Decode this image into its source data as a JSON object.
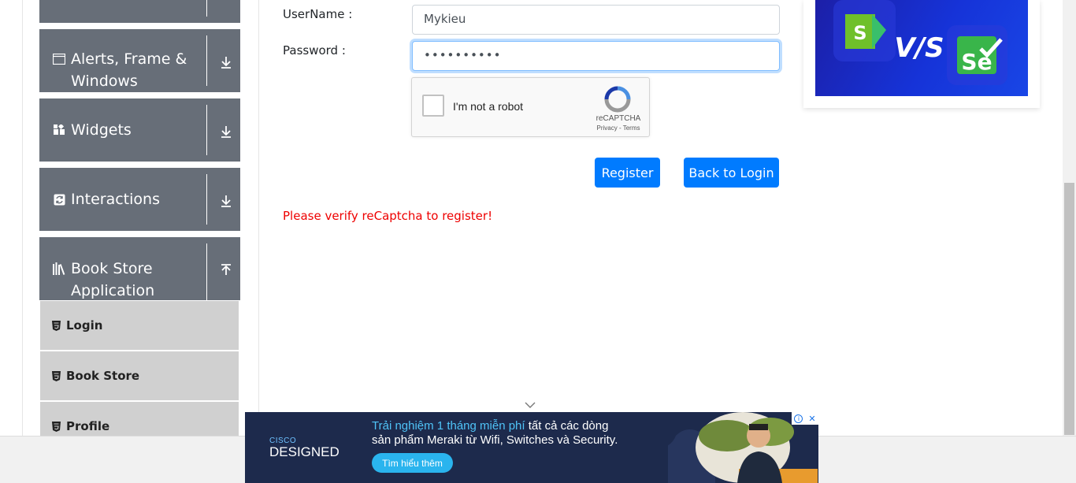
{
  "sidebar": {
    "groups": [
      {
        "label": "Alerts, Frame &",
        "label2": "Windows",
        "icon": "window-icon",
        "arrow": "download-arrow-icon"
      },
      {
        "label": "Widgets",
        "icon": "widgets-grid-icon",
        "arrow": "download-arrow-icon"
      },
      {
        "label": "Interactions",
        "icon": "interactions-icon",
        "arrow": "download-arrow-icon"
      },
      {
        "label": "Book Store",
        "label2": "Application",
        "icon": "books-icon",
        "arrow": "upload-arrow-icon"
      }
    ],
    "items": [
      {
        "label": "Login",
        "icon": "html5-icon"
      },
      {
        "label": "Book Store",
        "icon": "html5-icon"
      },
      {
        "label": "Profile",
        "icon": "html5-icon"
      }
    ]
  },
  "form": {
    "username_label": "UserName :",
    "username_value": "Mykieu",
    "password_label": "Password :",
    "password_value": "••••••••••",
    "captcha_text": "I'm not a robot",
    "captcha_brand": "reCAPTCHA",
    "captcha_terms": "Privacy - Terms",
    "register_label": "Register",
    "back_label": "Back to Login",
    "error": "Please verify reCaptcha to register!"
  },
  "ad_right": {
    "left_letter": "S",
    "vs_text": "V/S",
    "right_letter": "Se"
  },
  "banner": {
    "brand_top": "CISCO",
    "brand_main": "DESIGNED",
    "line1_highlight": "Trải nghiệm 1 tháng miễn phí",
    "line1_rest": " tất cả các dòng",
    "line2": "sản phẩm Meraki từ Wifi, Switches và Security.",
    "cta": "Tìm hiểu thêm",
    "info_glyph": "i",
    "close_glyph": "✕"
  },
  "colors": {
    "sidebar_group": "#676e78",
    "sidebar_item": "#d0d0d0",
    "primary": "#007bff",
    "error": "#e00000"
  }
}
